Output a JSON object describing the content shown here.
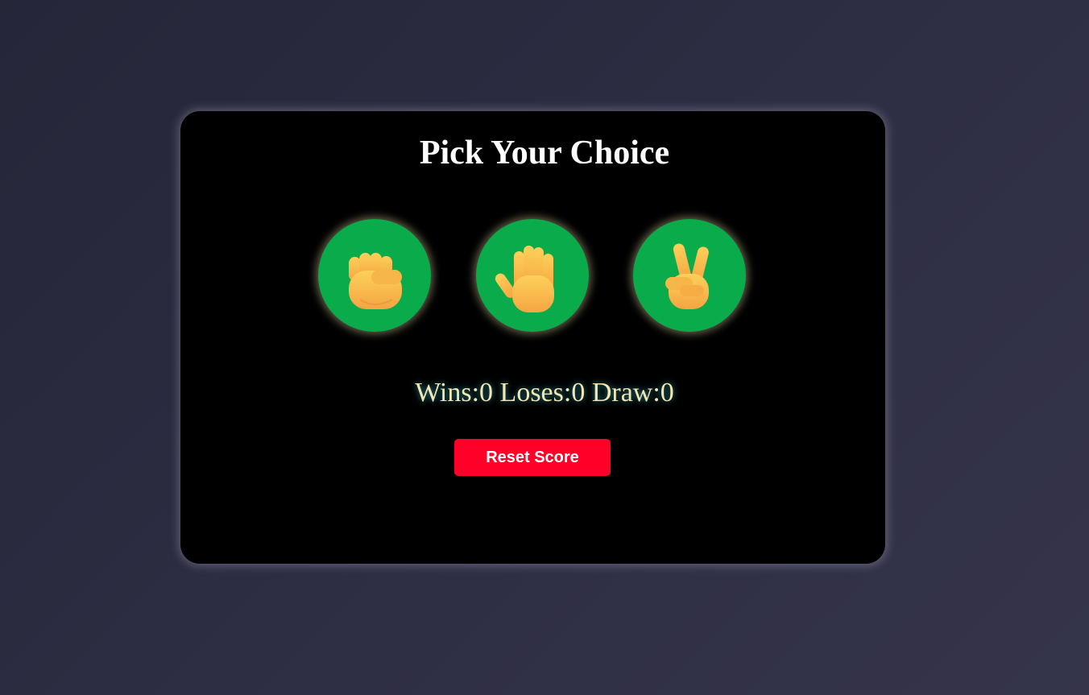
{
  "game": {
    "title": "Pick Your Choice",
    "choices": [
      {
        "id": "rock",
        "icon": "raised-fist-icon"
      },
      {
        "id": "paper",
        "icon": "raised-hand-icon"
      },
      {
        "id": "scissors",
        "icon": "victory-hand-icon"
      }
    ],
    "score": {
      "wins_label": "Wins:",
      "wins": "0",
      "loses_label": "Loses:",
      "loses": "0",
      "draw_label": "Draw:",
      "draw": "0"
    },
    "reset_label": "Reset Score"
  },
  "colors": {
    "background": "#2d2d43",
    "card": "#000000",
    "choice_circle": "#0aab4b",
    "score_text": "#f3e6b4",
    "reset_button": "#ff0029",
    "hand_skin": "#fbbf3d"
  }
}
